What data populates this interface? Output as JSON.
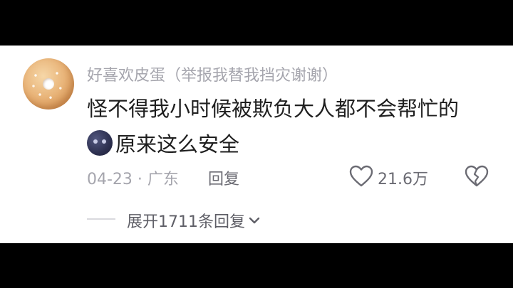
{
  "comment": {
    "username": "好喜欢皮蛋（举报我替我挡灾谢谢）",
    "text_line1": "怪不得我小时候被欺负大人都不会帮忙的",
    "text_line2": "原来这么安全",
    "emoji_icon": "moon-face-icon",
    "date_location": "04-23 · 广东",
    "reply_label": "回复",
    "like_count": "21.6万",
    "expand_replies": "展开1711条回复"
  },
  "colors": {
    "background": "#ffffff",
    "letterbox": "#000000",
    "meta_text": "#a5a5ad",
    "body_text": "#1f1f1f"
  }
}
